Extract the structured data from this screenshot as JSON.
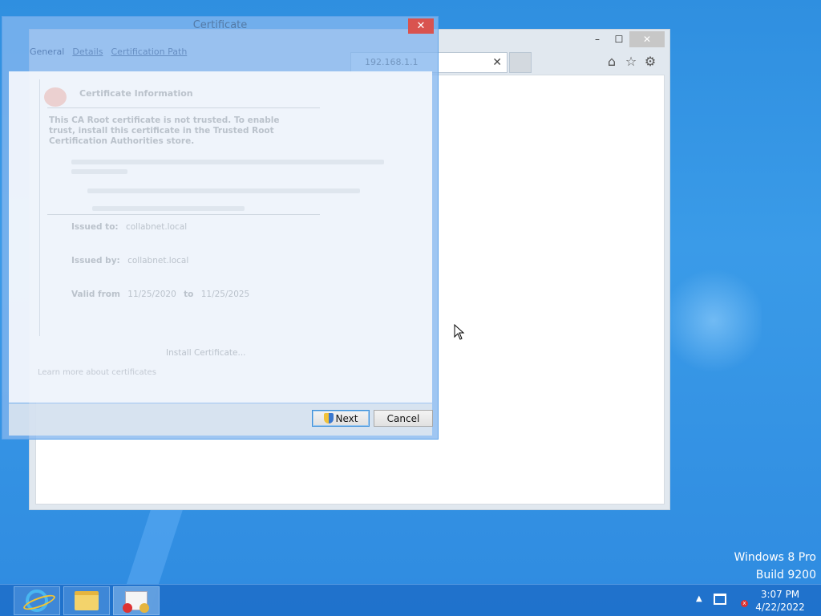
{
  "desktop": {
    "watermark_line1": "Windows 8 Pro",
    "watermark_line2": "Build 9200"
  },
  "ie": {
    "minimize": "–",
    "maximize": "☐",
    "close": "✕",
    "tab_close": "✕",
    "home_icon": "⌂",
    "favorites_icon": "☆",
    "tools_icon": "⚙"
  },
  "certificate_dialog": {
    "title": "Certificate",
    "close": "✕",
    "tabs": [
      "General",
      "Details",
      "Certification Path"
    ],
    "address_hint": "192.168.1.1",
    "info_title": "Certificate Information",
    "warning": "This CA Root certificate is not trusted. To enable trust, install this certificate in the Trusted Root Certification Authorities store.",
    "issued_to_label": "Issued to:",
    "issued_to_value": "collabnet.local",
    "issued_by_label": "Issued by:",
    "issued_by_value": "collabnet.local",
    "valid_from_label": "Valid from",
    "valid_from_value": "11/25/2020",
    "valid_to_label": "to",
    "valid_to_value": "11/25/2025",
    "install_button": "Install Certificate...",
    "learn_more": "Learn more about certificates",
    "next_button": "Next",
    "cancel_button": "Cancel"
  },
  "taskbar": {
    "time": "3:07 PM",
    "date": "4/22/2022",
    "tray_arrow": "▲"
  }
}
